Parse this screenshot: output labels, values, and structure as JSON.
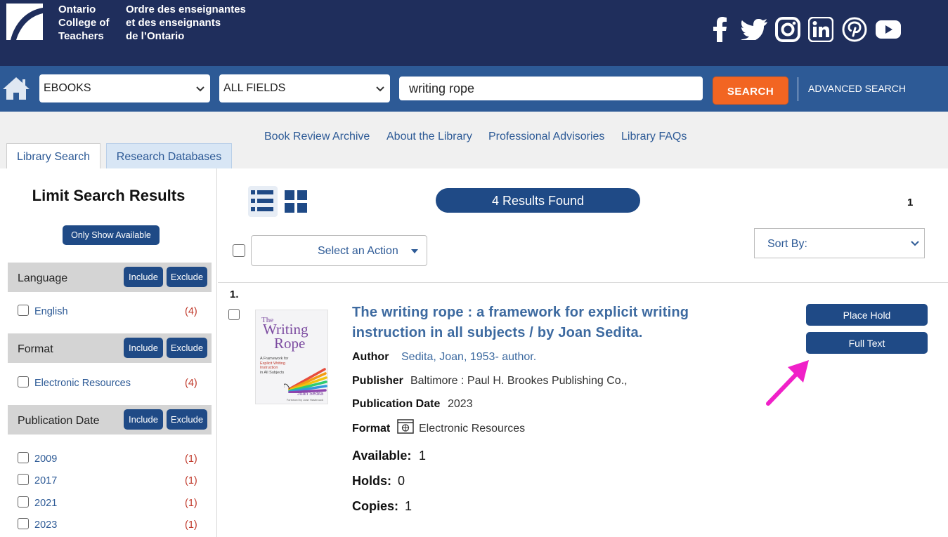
{
  "header": {
    "logo_en": [
      "Ontario",
      "College of",
      "Teachers"
    ],
    "logo_fr": [
      "Ordre des enseignantes",
      "et des enseignants",
      "de l’Ontario"
    ],
    "social_icons": [
      "facebook-icon",
      "twitter-icon",
      "instagram-icon",
      "linkedin-icon",
      "pinterest-icon",
      "youtube-icon"
    ]
  },
  "search": {
    "collection": "EBOOKS",
    "field": "ALL FIELDS",
    "query": "writing rope",
    "search_label": "SEARCH",
    "advanced_label": "ADVANCED SEARCH"
  },
  "nav_links": [
    "Book Review Archive",
    "About the Library",
    "Professional Advisories",
    "Library FAQs"
  ],
  "tabs": [
    "Library Search",
    "Research Databases"
  ],
  "sidebar": {
    "title": "Limit Search Results",
    "only_available": "Only Show Available",
    "include": "Include",
    "exclude": "Exclude",
    "facets": [
      {
        "name": "Language",
        "items": [
          {
            "label": "English",
            "count": "(4)"
          }
        ]
      },
      {
        "name": "Format",
        "items": [
          {
            "label": "Electronic Resources",
            "count": "(4)"
          }
        ]
      },
      {
        "name": "Publication Date",
        "items": [
          {
            "label": "2009",
            "count": "(1)"
          },
          {
            "label": "2017",
            "count": "(1)"
          },
          {
            "label": "2021",
            "count": "(1)"
          },
          {
            "label": "2023",
            "count": "(1)"
          }
        ]
      }
    ]
  },
  "results": {
    "count_label": "4 Results Found",
    "page": "1",
    "action_placeholder": "Select an Action",
    "sort_label": "Sort By:"
  },
  "record": {
    "number": "1.",
    "cover": {
      "line1": "The",
      "line2": "Writing",
      "line3": "Rope",
      "sub": [
        "A Framework for",
        "Explicit Writing",
        "Instruction",
        "in All Subjects"
      ],
      "author": "Joan Sedita",
      "foreword": "Foreword by Joan Hasbrouck"
    },
    "title": "The writing rope : a framework for explicit writing instruction in all subjects / by Joan Sedita.",
    "author_label": "Author",
    "author": "Sedita, Joan, 1953- author.",
    "publisher_label": "Publisher",
    "publisher": "Baltimore : Paul H. Brookes Publishing Co.,",
    "pubdate_label": "Publication Date",
    "pubdate": "2023",
    "format_label": "Format",
    "format": "Electronic Resources",
    "available_label": "Available:",
    "available": "1",
    "holds_label": "Holds:",
    "holds": "0",
    "copies_label": "Copies:",
    "copies": "1",
    "place_hold": "Place Hold",
    "full_text": "Full Text"
  },
  "colors": {
    "header_bg": "#1f2e5c",
    "searchbar_bg": "#2d5a96",
    "search_button": "#f26522",
    "primary_button": "#1f4a86",
    "link": "#2d5a96",
    "count_red": "#c0392b",
    "annotation_arrow": "#f020c8"
  }
}
